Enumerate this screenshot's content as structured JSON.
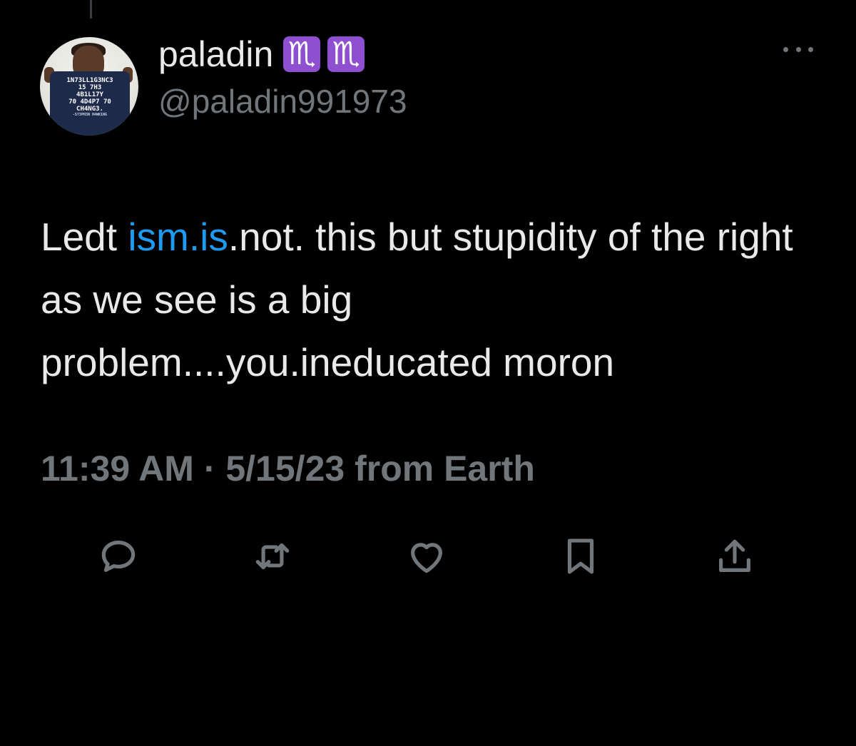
{
  "tweet": {
    "author": {
      "display_name": "paladin",
      "emojis": [
        "♏",
        "♏"
      ],
      "handle": "@paladin991973",
      "avatar_shirt_lines": [
        "1N73LL1G3NC3",
        "15 7H3",
        "4B1L17Y",
        "70 4D4P7 70",
        "CH4NG3."
      ],
      "avatar_shirt_signature": "-S73PH3N H4WK1NG"
    },
    "text": {
      "before_link": "Ledt ",
      "link": "ism.is",
      "after_link": ".not. this but stupidity of the right as we see is a big problem....you.ineducated moron"
    },
    "meta": {
      "time": "11:39 AM",
      "separator": " · ",
      "date": "5/15/23",
      "source": " from Earth"
    },
    "actions": [
      {
        "name": "reply-icon"
      },
      {
        "name": "retweet-icon"
      },
      {
        "name": "like-icon"
      },
      {
        "name": "bookmark-icon"
      },
      {
        "name": "share-icon"
      }
    ]
  },
  "colors": {
    "background": "#000000",
    "primary_text": "#e7e9ea",
    "secondary_text": "#71767b",
    "link": "#1d9bf0",
    "emoji_bg": "#8e4fd0"
  }
}
